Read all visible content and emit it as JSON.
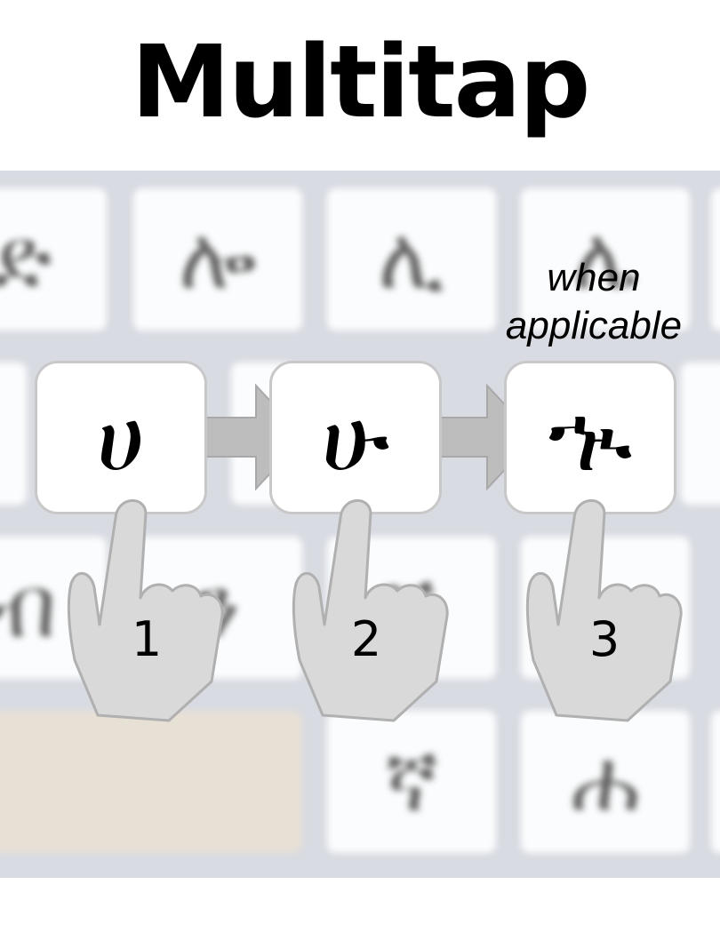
{
  "title": "Multitap",
  "note": {
    "line1": "when",
    "line2": "applicable"
  },
  "taps": [
    {
      "glyph": "ሀ",
      "step": "1"
    },
    {
      "glyph": "ሁ",
      "step": "2"
    },
    {
      "glyph": "ኊ",
      "step": "3"
    }
  ],
  "background_keys": {
    "row1": [
      "ድ",
      "ሎ",
      "ሊ",
      "ሌ"
    ],
    "row3": [
      "ብ",
      "ን",
      "ሽ"
    ],
    "row4": [
      "ኛ",
      "ሐ"
    ]
  },
  "colors": {
    "keyboard_bg": "#d8dbe2",
    "key_face": "#fbfcfd",
    "spacebar": "#e7e0d5",
    "arrow": "#bdbdbd",
    "hand_fill": "#d9d9d9",
    "hand_stroke": "#b0b0b0"
  },
  "icons": [
    "pointing-hand-icon",
    "arrow-right-icon"
  ]
}
